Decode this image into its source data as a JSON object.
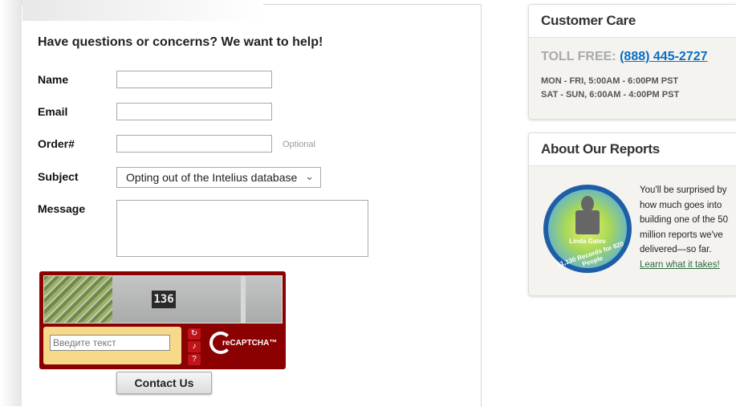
{
  "form": {
    "heading": "Have questions or concerns? We want to help!",
    "name_label": "Name",
    "email_label": "Email",
    "order_label": "Order#",
    "order_hint": "Optional",
    "subject_label": "Subject",
    "subject_value": "Opting out of the Intelius database",
    "message_label": "Message",
    "submit_label": "Contact Us"
  },
  "captcha": {
    "image_text": "136",
    "placeholder": "Введите текст",
    "reload_icon": "reload-icon",
    "audio_icon": "audio-icon",
    "help_icon": "help-icon",
    "logo_text": "reCAPTCHA™"
  },
  "customer_care": {
    "title": "Customer Care",
    "toll_label": "TOLL FREE:",
    "toll_number": "(888) 445-2727",
    "hours_weekday": "MON - FRI, 5:00AM - 6:00PM PST",
    "hours_weekend": "SAT - SUN, 6:00AM - 4:00PM PST"
  },
  "about_reports": {
    "title": "About Our Reports",
    "badge_name": "Linda Gates",
    "badge_records": "11,130 Records for 820 People",
    "body": "You'll be surprised by how much goes into building one of the 50 million reports we've delivered—so far.",
    "link": "Learn what it takes!"
  },
  "colors": {
    "captcha_bg": "#8b0000",
    "link_blue": "#0a6fc2",
    "link_green": "#2b6a3c"
  }
}
